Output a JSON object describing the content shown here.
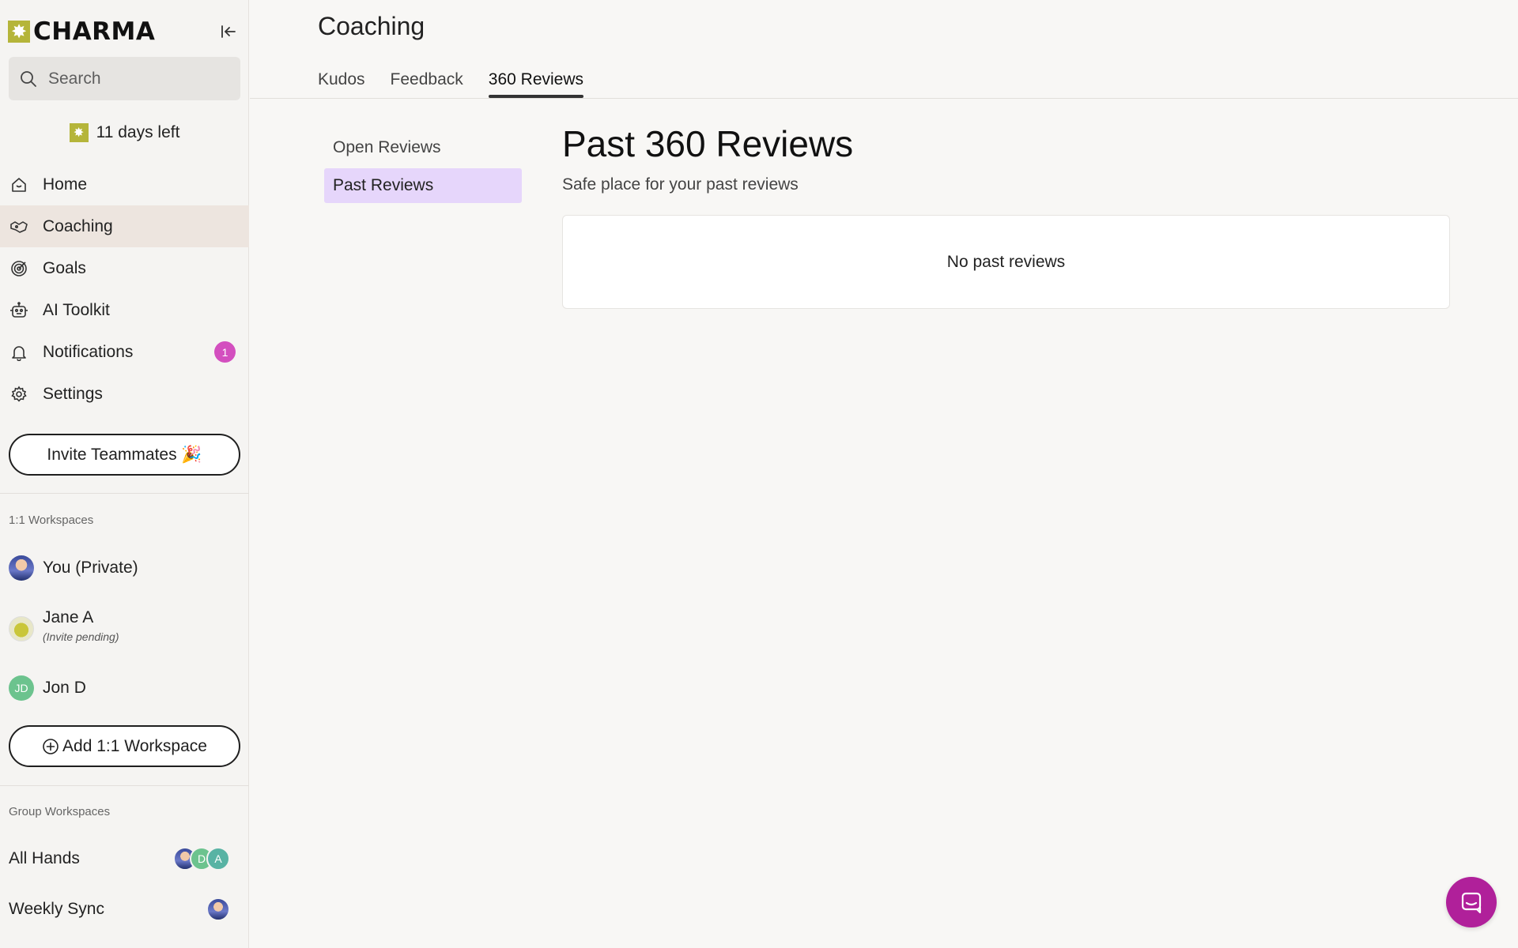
{
  "app": {
    "brand": "CHARMA"
  },
  "sidebar": {
    "search_placeholder": "Search",
    "trial_text": "11 days left",
    "nav": [
      {
        "label": "Home",
        "icon": "home-icon"
      },
      {
        "label": "Coaching",
        "icon": "coaching-icon",
        "active": true
      },
      {
        "label": "Goals",
        "icon": "target-icon"
      },
      {
        "label": "AI Toolkit",
        "icon": "robot-icon"
      },
      {
        "label": "Notifications",
        "icon": "bell-icon",
        "count": "1"
      },
      {
        "label": "Settings",
        "icon": "gear-icon"
      }
    ],
    "invite_label": "Invite Teammates 🎉",
    "one_on_one_heading": "1:1 Workspaces",
    "one_on_one": [
      {
        "name": "You (Private)"
      },
      {
        "name": "Jane A",
        "sub": "(Invite pending)"
      },
      {
        "name": "Jon D",
        "initials": "JD"
      }
    ],
    "add_workspace_label": "Add 1:1 Workspace",
    "group_heading": "Group Workspaces",
    "groups": [
      {
        "name": "All Hands",
        "avatars": [
          "D",
          "A"
        ]
      },
      {
        "name": "Weekly Sync"
      }
    ]
  },
  "main": {
    "title": "Coaching",
    "tabs": [
      {
        "label": "Kudos"
      },
      {
        "label": "Feedback"
      },
      {
        "label": "360 Reviews",
        "active": true
      }
    ],
    "subnav": [
      {
        "label": "Open Reviews"
      },
      {
        "label": "Past Reviews",
        "active": true
      }
    ],
    "heading": "Past 360 Reviews",
    "subheading": "Safe place for your past reviews",
    "empty_text": "No past reviews"
  },
  "colors": {
    "accent_purple": "#e6d6fb",
    "badge_pink": "#d34fbf",
    "chat_purple": "#b0209a",
    "brand_olive": "#b5b53a",
    "active_nav": "#ede5df"
  }
}
